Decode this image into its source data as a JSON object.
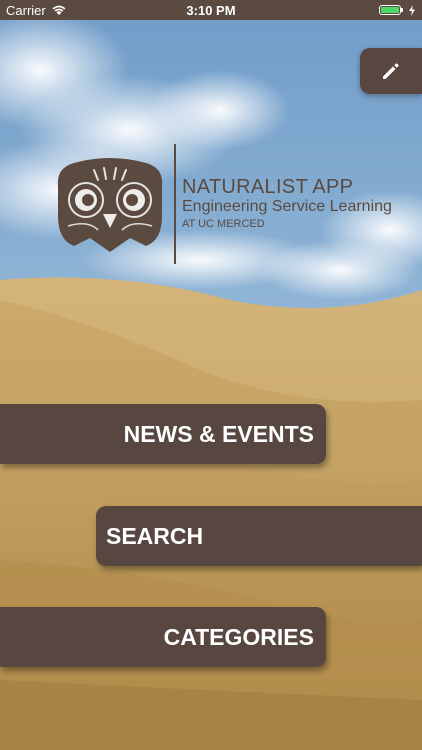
{
  "status_bar": {
    "carrier": "Carrier",
    "time": "3:10 PM",
    "battery_level": 1.0,
    "icons": [
      "wifi-icon",
      "battery-icon",
      "charging-icon"
    ]
  },
  "header": {
    "edit_icon": "pencil-icon"
  },
  "logo": {
    "app_name": "NATURALIST APP",
    "subtitle": "Engineering Service Learning",
    "org": "AT UC MERCED",
    "icon": "owl-logo-icon"
  },
  "menu": {
    "news_events": "NEWS & EVENTS",
    "search": "SEARCH",
    "categories": "CATEGORIES"
  },
  "colors": {
    "brand_brown": "#574740",
    "status_bar": "#5a4a40",
    "battery_green": "#4cd964"
  }
}
